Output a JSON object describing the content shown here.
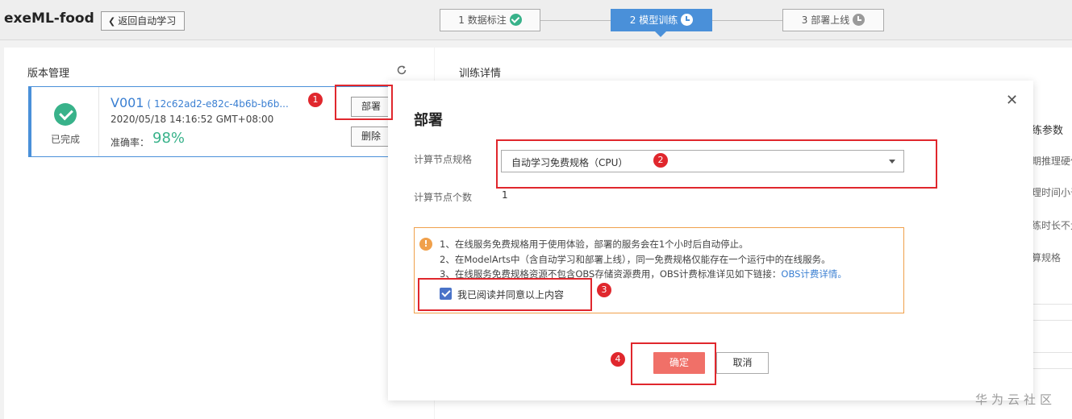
{
  "header": {
    "app_title": "exeML-food",
    "back_label": "返回自动学习",
    "steps": [
      {
        "label": "1 数据标注"
      },
      {
        "label": "2 模型训练"
      },
      {
        "label": "3 部署上线"
      }
    ]
  },
  "version_panel": {
    "title": "版本管理",
    "card": {
      "status": "已完成",
      "version": "V001",
      "hash": "( 12c62ad2-e82c-4b6b-b6b...",
      "date": "2020/05/18 14:16:52 GMT+08:00",
      "accuracy_label": "准确率：",
      "accuracy_value": "98%"
    },
    "deploy_label": "部署",
    "delete_label": "删除"
  },
  "detail_panel": {
    "title": "训练详情",
    "items": [
      "练参数",
      "期推理硬件",
      "理时间小于",
      "练时长不大",
      "算规格"
    ]
  },
  "modal": {
    "title": "部署",
    "spec_label": "计算节点规格",
    "spec_value": "自动学习免费规格（CPU）",
    "count_label": "计算节点个数",
    "count_value": "1",
    "notices": [
      "1、在线服务免费规格用于使用体验，部署的服务会在1个小时后自动停止。",
      "2、在ModelArts中（含自动学习和部署上线），同一免费规格仅能存在一个运行中的在线服务。",
      "3、在线服务免费规格资源不包含OBS存储资源费用，OBS计费标准详见如下链接："
    ],
    "notice_link": "OBS计费详情。",
    "agree_label": "我已阅读并同意以上内容",
    "ok_label": "确定",
    "cancel_label": "取消"
  },
  "annotations": [
    "1",
    "2",
    "3",
    "4"
  ],
  "watermark": "华为云社区",
  "colors": {
    "primary": "#4a90d9",
    "success": "#38b28a",
    "danger_button": "#f07068",
    "warning": "#f0a04b",
    "annotation": "#e0272d"
  }
}
